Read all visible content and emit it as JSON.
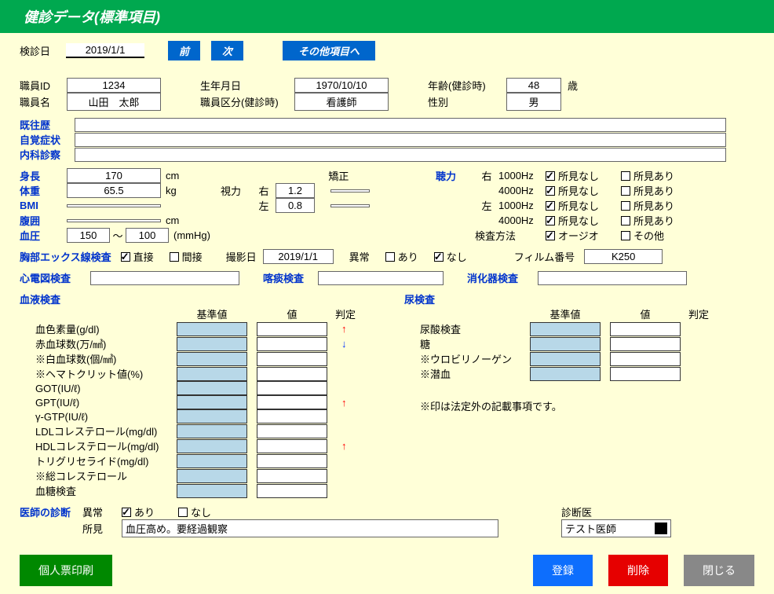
{
  "title": "健診データ(標準項目)",
  "top": {
    "exam_date_label": "検診日",
    "exam_date": "2019/1/1",
    "prev": "前",
    "next": "次",
    "other_items": "その他項目へ"
  },
  "staff": {
    "id_label": "職員ID",
    "id": "1234",
    "name_label": "職員名",
    "name": "山田　太郎",
    "dob_label": "生年月日",
    "dob": "1970/10/10",
    "class_label": "職員区分(健診時)",
    "class": "看護師",
    "age_label": "年齢(健診時)",
    "age": "48",
    "age_unit": "歳",
    "sex_label": "性別",
    "sex": "男"
  },
  "history": {
    "past": "既往歴",
    "subjective": "自覚症状",
    "internal": "内科診察"
  },
  "body": {
    "height_label": "身長",
    "height": "170",
    "cm": "cm",
    "weight_label": "体重",
    "weight": "65.5",
    "kg": "kg",
    "bmi_label": "BMI",
    "waist_label": "腹囲",
    "bp_label": "血圧",
    "bp_hi": "150",
    "bp_lo": "100",
    "tilde": "～",
    "mmhg": "(mmHg)",
    "vision_label": "視力",
    "right": "右",
    "left": "左",
    "vis_r": "1.2",
    "vis_l": "0.8",
    "corrected": "矯正",
    "hearing_label": "聴力",
    "hz1000": "1000Hz",
    "hz4000": "4000Hz",
    "no_finding": "所見なし",
    "has_finding": "所見あり",
    "method_label": "検査方法",
    "audio": "オージオ",
    "other": "その他"
  },
  "xray": {
    "label": "胸部エックス線検査",
    "direct": "直接",
    "indirect": "間接",
    "film_date_label": "撮影日",
    "film_date": "2019/1/1",
    "abnormal": "異常",
    "yes": "あり",
    "no": "なし",
    "film_no_label": "フィルム番号",
    "film_no": "K250"
  },
  "ecg_label": "心電図検査",
  "sputum_label": "喀痰検査",
  "digest_label": "消化器検査",
  "blood": {
    "label": "血液検査",
    "ref": "基準値",
    "val": "値",
    "judge": "判定",
    "items": [
      "血色素量(g/dl)",
      "赤血球数(万/㎣)",
      "※白血球数(個/㎣)",
      "※ヘマトクリット値(%)",
      "GOT(IU/ℓ)",
      "GPT(IU/ℓ)",
      "γ-GTP(IU/ℓ)",
      "LDLコレステロール(mg/dl)",
      "HDLコレステロール(mg/dl)",
      "トリグリセライド(mg/dl)",
      "※総コレステロール",
      "血糖検査"
    ],
    "judges": [
      "↑",
      "↓",
      "",
      "",
      "",
      "↑",
      "",
      "",
      "↑",
      "",
      "",
      ""
    ]
  },
  "urine": {
    "label": "尿検査",
    "ref": "基準値",
    "val": "値",
    "judge": "判定",
    "items": [
      "尿酸検査",
      "糖",
      "※ウロビリノーゲン",
      "※潜血"
    ],
    "note": "※印は法定外の記載事項です。"
  },
  "diag": {
    "label": "医師の診断",
    "abnormal": "異常",
    "yes": "あり",
    "no": "なし",
    "findings_label": "所見",
    "findings": "血圧高め。要経過観察",
    "doctor_label": "診断医",
    "doctor": "テスト医師"
  },
  "buttons": {
    "print": "個人票印刷",
    "register": "登録",
    "delete": "削除",
    "close": "閉じる"
  }
}
